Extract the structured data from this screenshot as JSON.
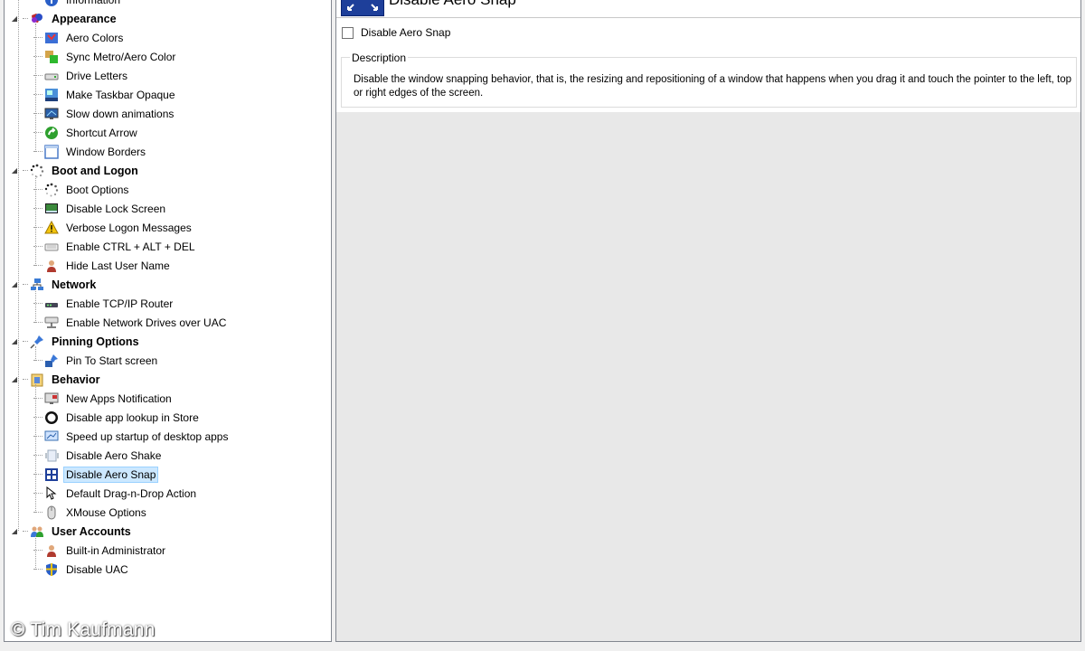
{
  "tree": {
    "top_partial": "Information",
    "categories": [
      {
        "label": "Appearance",
        "icon": "appearance-icon",
        "items": [
          {
            "label": "Aero Colors",
            "icon": "aero-colors-icon"
          },
          {
            "label": "Sync Metro/Aero Color",
            "icon": "sync-color-icon"
          },
          {
            "label": "Drive Letters",
            "icon": "drive-icon"
          },
          {
            "label": "Make Taskbar Opaque",
            "icon": "taskbar-icon"
          },
          {
            "label": "Slow down animations",
            "icon": "monitor-icon"
          },
          {
            "label": "Shortcut Arrow",
            "icon": "shortcut-arrow-icon"
          },
          {
            "label": "Window Borders",
            "icon": "window-icon"
          }
        ]
      },
      {
        "label": "Boot and Logon",
        "icon": "boot-spinner-icon",
        "items": [
          {
            "label": "Boot Options",
            "icon": "boot-spinner-icon"
          },
          {
            "label": "Disable Lock Screen",
            "icon": "lock-screen-icon"
          },
          {
            "label": "Verbose Logon Messages",
            "icon": "warning-icon"
          },
          {
            "label": "Enable CTRL + ALT + DEL",
            "icon": "keyboard-icon"
          },
          {
            "label": "Hide Last User Name",
            "icon": "user-icon"
          }
        ]
      },
      {
        "label": "Network",
        "icon": "network-icon",
        "items": [
          {
            "label": "Enable TCP/IP Router",
            "icon": "router-icon"
          },
          {
            "label": "Enable Network Drives over UAC",
            "icon": "network-drive-icon"
          }
        ]
      },
      {
        "label": "Pinning Options",
        "icon": "pin-icon",
        "items": [
          {
            "label": "Pin To Start screen",
            "icon": "pin-start-icon"
          }
        ]
      },
      {
        "label": "Behavior",
        "icon": "behavior-icon",
        "items": [
          {
            "label": "New Apps Notification",
            "icon": "notification-icon"
          },
          {
            "label": "Disable app lookup in Store",
            "icon": "store-icon"
          },
          {
            "label": "Speed up startup of desktop apps",
            "icon": "startup-icon"
          },
          {
            "label": "Disable Aero Shake",
            "icon": "aero-shake-icon"
          },
          {
            "label": "Disable Aero Snap",
            "icon": "aero-snap-icon",
            "selected": true
          },
          {
            "label": "Default Drag-n-Drop Action",
            "icon": "cursor-icon"
          },
          {
            "label": "XMouse Options",
            "icon": "mouse-icon"
          }
        ]
      },
      {
        "label": "User Accounts",
        "icon": "users-icon",
        "items": [
          {
            "label": "Built-in Administrator",
            "icon": "user-icon"
          },
          {
            "label": "Disable UAC",
            "icon": "uac-shield-icon"
          }
        ]
      }
    ]
  },
  "detail": {
    "title": "Disable Aero Snap",
    "icon": "aero-snap-icon",
    "option_label": "Disable Aero Snap",
    "option_checked": false,
    "description_title": "Description",
    "description_text": "Disable the window snapping behavior, that is, the resizing and repositioning of a window that happens when you drag it and touch the pointer to the left, top or right edges of the screen."
  },
  "watermark": "© Tim Kaufmann"
}
